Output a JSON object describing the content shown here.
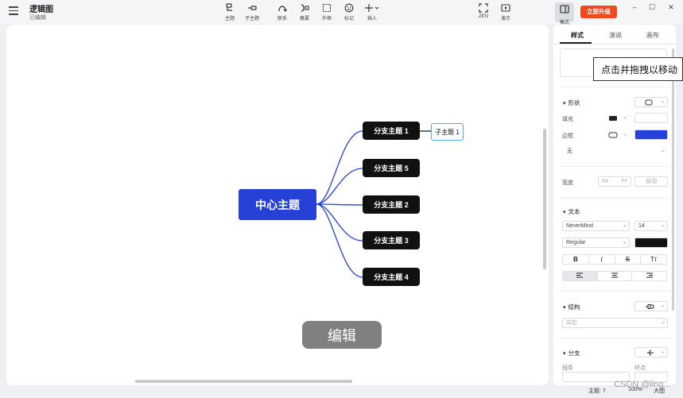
{
  "header": {
    "title": "逻辑图",
    "status": "已编辑"
  },
  "toolbar": {
    "tools": [
      {
        "label": "主题",
        "icon": "topic-icon"
      },
      {
        "label": "子主题",
        "icon": "subtopic-icon"
      },
      {
        "label": "联系",
        "icon": "relationship-icon"
      },
      {
        "label": "概要",
        "icon": "summary-icon"
      },
      {
        "label": "外框",
        "icon": "boundary-icon"
      },
      {
        "label": "标记",
        "icon": "marker-smiley-icon"
      },
      {
        "label": "插入",
        "icon": "insert-plus-icon"
      }
    ],
    "zen_label": "ZEN",
    "present_label": "演示",
    "format_label": "格式",
    "upgrade_label": "立即升级"
  },
  "window": {
    "minimize": "–",
    "maximize": "☐",
    "close": "✕"
  },
  "mindmap": {
    "root": "中心主题",
    "branches": [
      "分支主题 1",
      "分支主题 5",
      "分支主题 2",
      "分支主题 3",
      "分支主题 4"
    ],
    "subtopic": "子主题 1",
    "edit_toast": "编辑"
  },
  "panel": {
    "tabs": [
      "样式",
      "演说",
      "画布"
    ],
    "tooltip": "点击并拖拽以移动",
    "shape": {
      "title": "形状",
      "fill_label": "填充",
      "border_label": "边框",
      "border_style": "无",
      "border_color": "#2541d6"
    },
    "width": {
      "label": "宽度",
      "value": "64",
      "unit": "PX",
      "auto": "自动"
    },
    "text": {
      "title": "文本",
      "font": "NeverMind",
      "size": "14",
      "weight": "Regular",
      "color": "#111111",
      "styles": [
        "B",
        "I",
        "S",
        "Tт"
      ]
    },
    "structure": {
      "title": "结构",
      "direction": "向右"
    },
    "branch": {
      "title": "分支",
      "line_label": "线条",
      "end_label": "终点"
    }
  },
  "statusbar": {
    "topics": "主题: 7",
    "zoom": "100%",
    "size": "大图"
  },
  "watermark": "CSDN @ling..."
}
